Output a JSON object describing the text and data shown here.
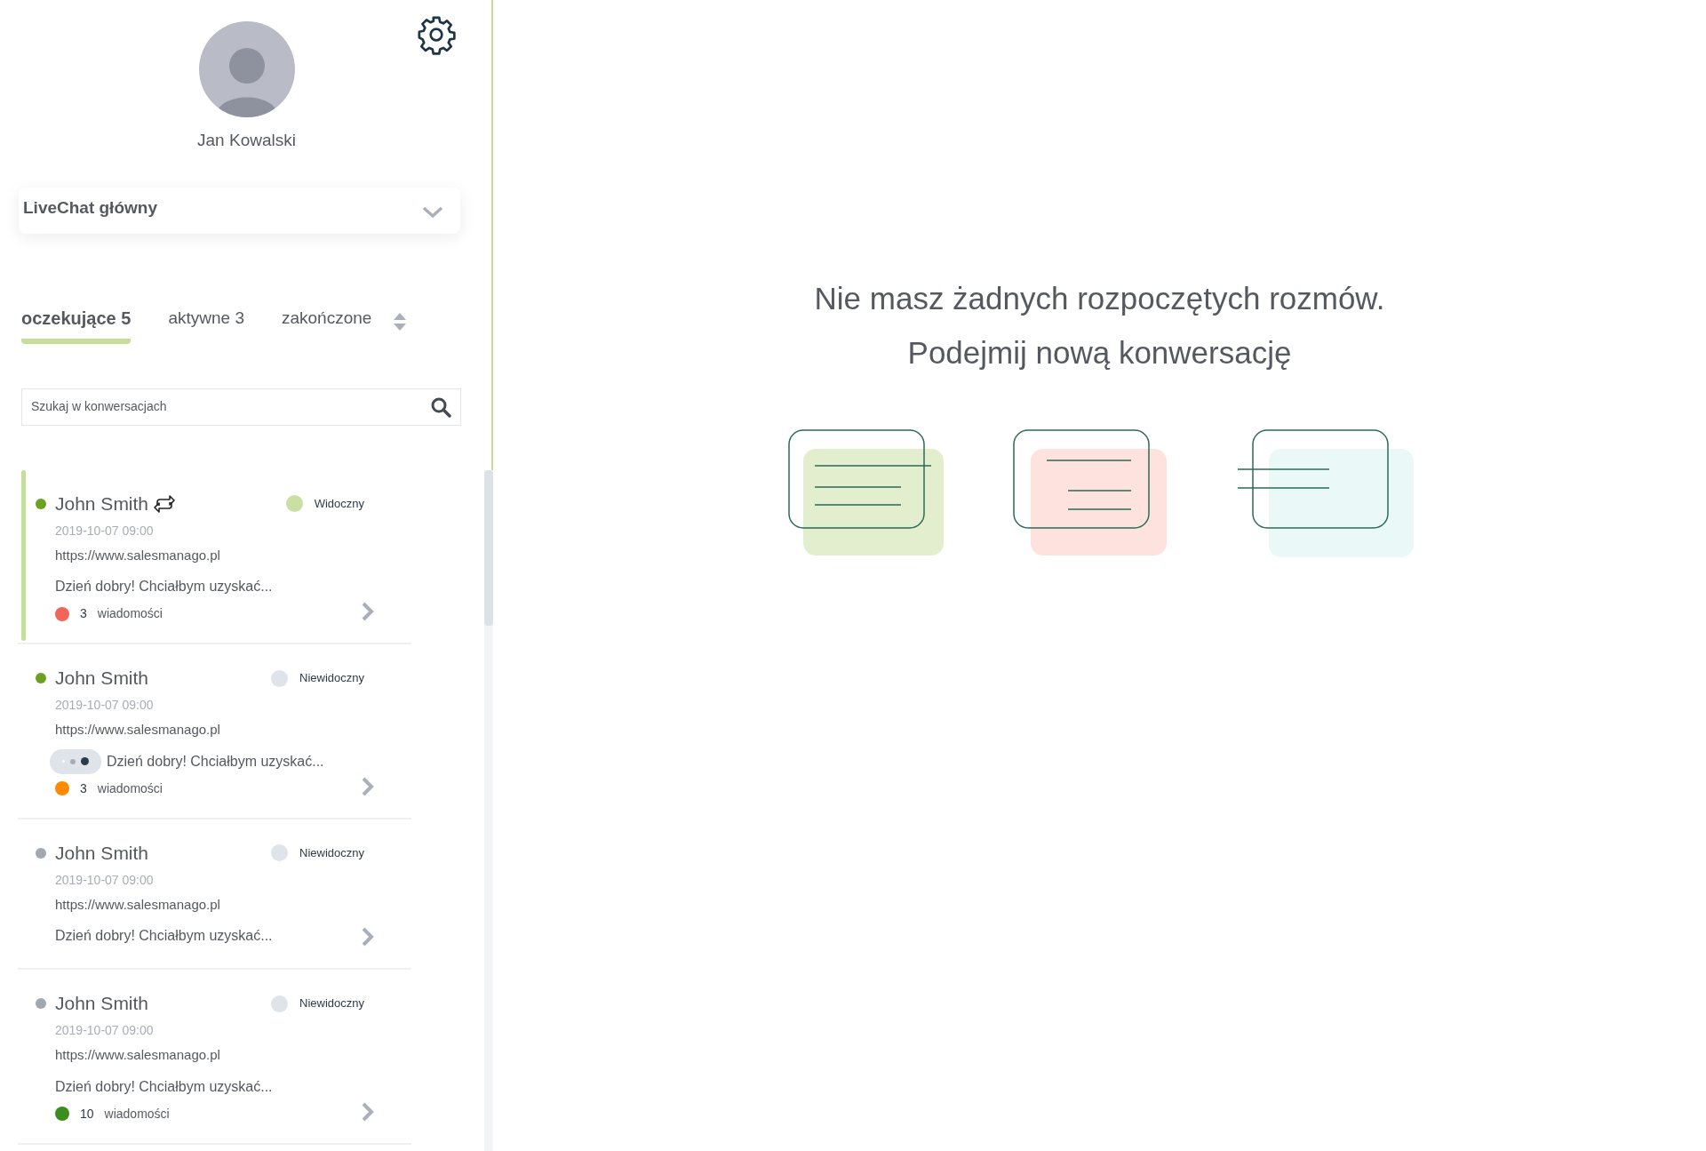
{
  "profile": {
    "name": "Jan Kowalski"
  },
  "channel_select": {
    "value": "LiveChat główny"
  },
  "tabs": [
    {
      "label": "oczekujące",
      "count": "5",
      "selected": true
    },
    {
      "label": "aktywne",
      "count": "3",
      "selected": false
    },
    {
      "label": "zakończone",
      "selected": false
    }
  ],
  "search": {
    "placeholder": "Szukaj w konwersacjach"
  },
  "conversations": [
    {
      "name": "John Smith",
      "online": {
        "color": "#6aa121"
      },
      "transferred": true,
      "visibility": "Widoczny",
      "visible": true,
      "date": "2019-10-07 09:00",
      "url": "https://www.salesmanago.pl",
      "typing": false,
      "message": "Dzień dobry! Chciałbym uzyskać...",
      "unread": {
        "count": "3",
        "label": "wiadomości",
        "color": "#f2665a"
      },
      "selected": true
    },
    {
      "name": "John Smith",
      "online": {
        "color": "#6aa121"
      },
      "transferred": false,
      "visibility": "Niewidoczny",
      "visible": false,
      "date": "2019-10-07 09:00",
      "url": "https://www.salesmanago.pl",
      "typing": true,
      "message": "Dzień dobry! Chciałbym uzyskać...",
      "unread": {
        "count": "3",
        "label": "wiadomości",
        "color": "#ff8a00"
      },
      "selected": false
    },
    {
      "name": "John Smith",
      "online": {
        "color": "#a0a8b2"
      },
      "transferred": false,
      "visibility": "Niewidoczny",
      "visible": false,
      "date": "2019-10-07 09:00",
      "url": "https://www.salesmanago.pl",
      "typing": false,
      "message": "Dzień dobry! Chciałbym uzyskać...",
      "selected": false
    },
    {
      "name": "John Smith",
      "online": {
        "color": "#a0a8b2"
      },
      "transferred": false,
      "visibility": "Niewidoczny",
      "visible": false,
      "date": "2019-10-07 09:00",
      "url": "https://www.salesmanago.pl",
      "typing": false,
      "message": "Dzień dobry! Chciałbym uzyskać...",
      "unread": {
        "count": "10",
        "label": "wiadomości",
        "color": "#3c8d1f"
      },
      "selected": false
    }
  ],
  "empty_state": {
    "lines": [
      "Nie masz żadnych rozpoczętych rozmów.",
      "Podejmij nową konwersację"
    ]
  }
}
